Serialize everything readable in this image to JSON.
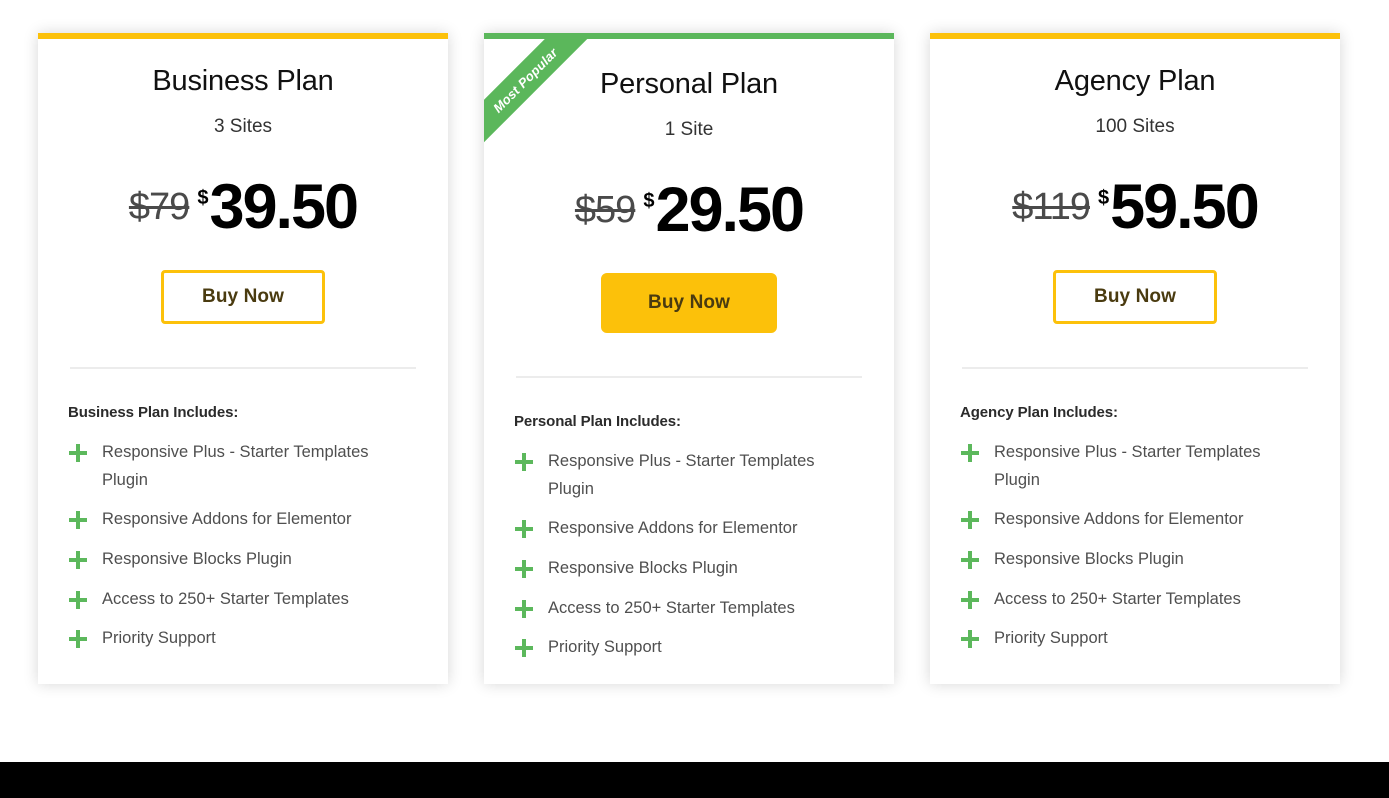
{
  "ribbon": {
    "label": "Most Popular"
  },
  "colors": {
    "accent_yellow": "#fcc10a",
    "accent_green": "#5bb75b",
    "plus_green": "#5cb85c",
    "button_text": "#4a3b10",
    "price_text": "#000000",
    "old_price_text": "#4a4a4a",
    "feature_text": "#4f4f4f",
    "divider": "#ececec",
    "bottom_bar": "#000000"
  },
  "plans": [
    {
      "name": "Business Plan",
      "sites": "3 Sites",
      "old_price": "$79",
      "currency": "$",
      "price": "39.50",
      "buy_label": "Buy Now",
      "features_title": "Business Plan Includes:",
      "features": [
        "Responsive Plus - Starter Templates Plugin",
        "Responsive Addons for Elementor",
        "Responsive Blocks Plugin",
        "Access to 250+ Starter Templates",
        "Priority Support"
      ],
      "popular": false
    },
    {
      "name": "Personal Plan",
      "sites": "1 Site",
      "old_price": "$59",
      "currency": "$",
      "price": "29.50",
      "buy_label": "Buy Now",
      "features_title": "Personal Plan Includes:",
      "features": [
        "Responsive Plus - Starter Templates Plugin",
        "Responsive Addons for Elementor",
        "Responsive Blocks Plugin",
        "Access to 250+ Starter Templates",
        "Priority Support"
      ],
      "popular": true
    },
    {
      "name": "Agency Plan",
      "sites": "100 Sites",
      "old_price": "$119",
      "currency": "$",
      "price": "59.50",
      "buy_label": "Buy Now",
      "features_title": "Agency Plan Includes:",
      "features": [
        "Responsive Plus - Starter Templates Plugin",
        "Responsive Addons for Elementor",
        "Responsive Blocks Plugin",
        "Access to 250+ Starter Templates",
        "Priority Support"
      ],
      "popular": false
    }
  ]
}
